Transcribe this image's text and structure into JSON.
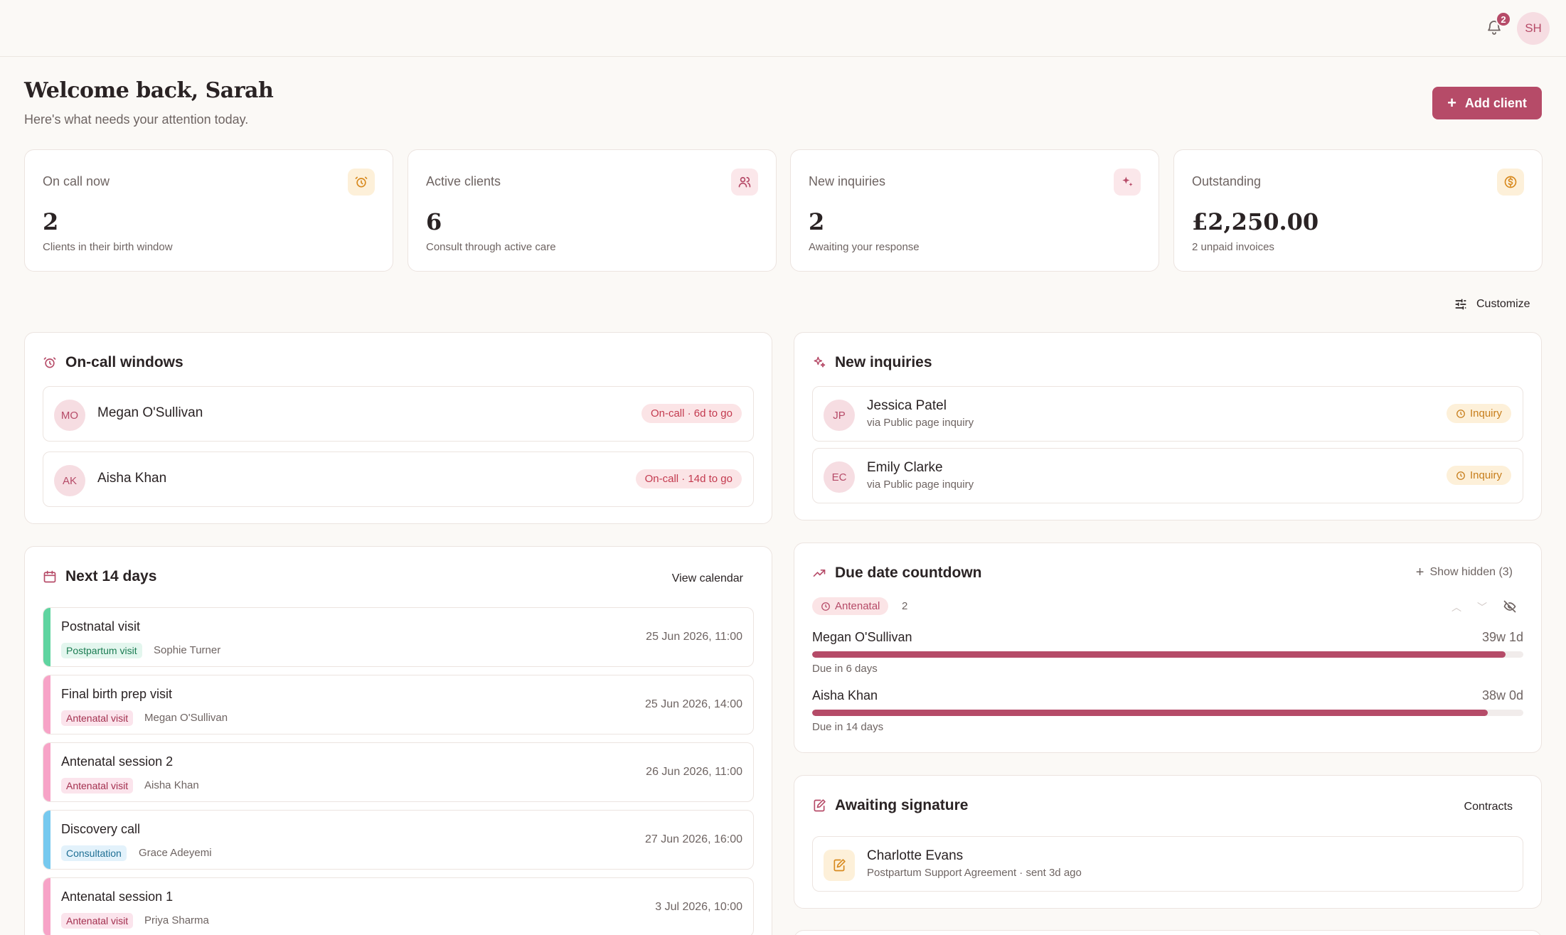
{
  "header": {
    "notifications_count": "2",
    "user_initials": "SH"
  },
  "welcome": {
    "title": "Welcome back, Sarah",
    "subtitle": "Here's what needs your attention today.",
    "add_client_label": "Add client"
  },
  "stats": [
    {
      "label": "On call now",
      "value": "2",
      "note": "Clients in their birth window",
      "icon": "alarm-clock-icon",
      "icon_bg": "#fdf0d9",
      "icon_color": "#d88a1f"
    },
    {
      "label": "Active clients",
      "value": "6",
      "note": "Consult through active care",
      "icon": "users-icon",
      "icon_bg": "#fbe7ea",
      "icon_color": "#b64b68"
    },
    {
      "label": "New inquiries",
      "value": "2",
      "note": "Awaiting your response",
      "icon": "sparkles-icon",
      "icon_bg": "#fbe7ea",
      "icon_color": "#b64b68"
    },
    {
      "label": "Outstanding",
      "value": "£2,250.00",
      "note": "2 unpaid invoices",
      "icon": "coin-icon",
      "icon_bg": "#fdf0d9",
      "icon_color": "#d88a1f"
    }
  ],
  "customize_label": "Customize",
  "oncall": {
    "title": "On-call windows",
    "items": [
      {
        "initials": "MO",
        "name": "Megan O'Sullivan",
        "status": "On-call · 6d to go"
      },
      {
        "initials": "AK",
        "name": "Aisha Khan",
        "status": "On-call · 14d to go"
      }
    ]
  },
  "inquiries": {
    "title": "New inquiries",
    "items": [
      {
        "initials": "JP",
        "name": "Jessica Patel",
        "source": "via Public page inquiry",
        "status": "Inquiry"
      },
      {
        "initials": "EC",
        "name": "Emily Clarke",
        "source": "via Public page inquiry",
        "status": "Inquiry"
      }
    ]
  },
  "next14": {
    "title": "Next 14 days",
    "link": "View calendar",
    "events": [
      {
        "title": "Postnatal visit",
        "tag": "Postpartum visit",
        "client": "Sophie Turner",
        "when": "25 Jun 2026, 11:00",
        "bar_color": "#5fd4a0",
        "tag_class": "tag-green"
      },
      {
        "title": "Final birth prep visit",
        "tag": "Antenatal visit",
        "client": "Megan O'Sullivan",
        "when": "25 Jun 2026, 14:00",
        "bar_color": "#f7a3c7",
        "tag_class": "tag-rose"
      },
      {
        "title": "Antenatal session 2",
        "tag": "Antenatal visit",
        "client": "Aisha Khan",
        "when": "26 Jun 2026, 11:00",
        "bar_color": "#f7a3c7",
        "tag_class": "tag-rose"
      },
      {
        "title": "Discovery call",
        "tag": "Consultation",
        "client": "Grace Adeyemi",
        "when": "27 Jun 2026, 16:00",
        "bar_color": "#76c9ef",
        "tag_class": "tag-blue"
      },
      {
        "title": "Antenatal session 1",
        "tag": "Antenatal visit",
        "client": "Priya Sharma",
        "when": "3 Jul 2026, 10:00",
        "bar_color": "#f7a3c7",
        "tag_class": "tag-rose"
      }
    ]
  },
  "countdown": {
    "title": "Due date countdown",
    "show_hidden": "Show hidden (3)",
    "group_label": "Antenatal",
    "group_count": "2",
    "items": [
      {
        "name": "Megan O'Sullivan",
        "weeks": "39w 1d",
        "due": "Due in 6 days",
        "progress": 0.975
      },
      {
        "name": "Aisha Khan",
        "weeks": "38w 0d",
        "due": "Due in 14 days",
        "progress": 0.95
      }
    ]
  },
  "signature": {
    "title": "Awaiting signature",
    "link": "Contracts",
    "items": [
      {
        "name": "Charlotte Evans",
        "detail": "Postpartum Support Agreement · sent 3d ago"
      }
    ]
  }
}
